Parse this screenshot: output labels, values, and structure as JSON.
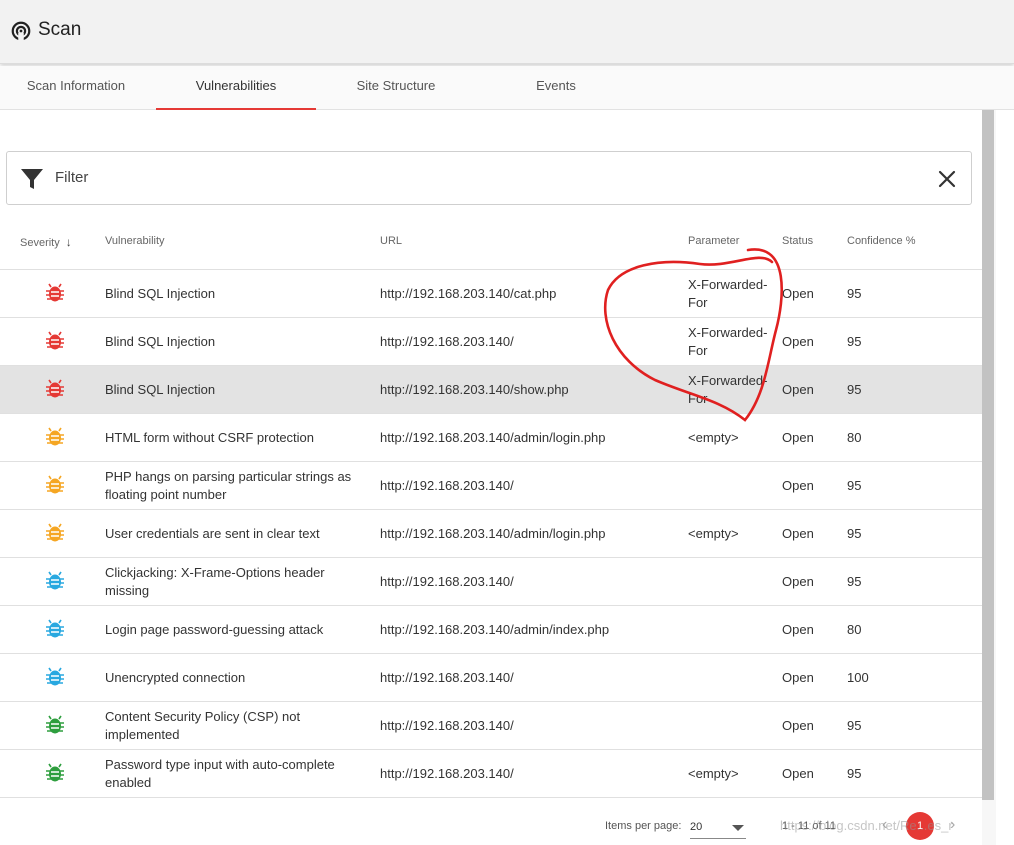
{
  "header": {
    "title": "Scan",
    "icon": "scan-radar-icon"
  },
  "tabs": [
    {
      "label": "Scan Information",
      "active": false
    },
    {
      "label": "Vulnerabilities",
      "active": true
    },
    {
      "label": "Site Structure",
      "active": false
    },
    {
      "label": "Events",
      "active": false
    }
  ],
  "filter": {
    "label": "Filter",
    "icon": "funnel-icon",
    "clear_icon": "close-icon"
  },
  "table": {
    "columns": {
      "severity": "Severity",
      "vulnerability": "Vulnerability",
      "url": "URL",
      "parameter": "Parameter",
      "status": "Status",
      "confidence": "Confidence %"
    },
    "rows": [
      {
        "severity": "high",
        "vulnerability": "Blind SQL Injection",
        "url": "http://192.168.203.140/cat.php",
        "parameter": "X-Forwarded-For",
        "status": "Open",
        "confidence": "95"
      },
      {
        "severity": "high",
        "vulnerability": "Blind SQL Injection",
        "url": "http://192.168.203.140/",
        "parameter": "X-Forwarded-For",
        "status": "Open",
        "confidence": "95"
      },
      {
        "severity": "high",
        "vulnerability": "Blind SQL Injection",
        "url": "http://192.168.203.140/show.php",
        "parameter": "X-Forwarded-For",
        "status": "Open",
        "confidence": "95"
      },
      {
        "severity": "medium",
        "vulnerability": "HTML form without CSRF protection",
        "url": "http://192.168.203.140/admin/login.php",
        "parameter": "<empty>",
        "status": "Open",
        "confidence": "80"
      },
      {
        "severity": "medium",
        "vulnerability": "PHP hangs on parsing particular strings as floating point number",
        "url": "http://192.168.203.140/",
        "parameter": "",
        "status": "Open",
        "confidence": "95"
      },
      {
        "severity": "medium",
        "vulnerability": "User credentials are sent in clear text",
        "url": "http://192.168.203.140/admin/login.php",
        "parameter": "<empty>",
        "status": "Open",
        "confidence": "95"
      },
      {
        "severity": "low",
        "vulnerability": "Clickjacking: X-Frame-Options header missing",
        "url": "http://192.168.203.140/",
        "parameter": "",
        "status": "Open",
        "confidence": "95"
      },
      {
        "severity": "low",
        "vulnerability": "Login page password-guessing attack",
        "url": "http://192.168.203.140/admin/index.php",
        "parameter": "",
        "status": "Open",
        "confidence": "80"
      },
      {
        "severity": "low",
        "vulnerability": "Unencrypted connection",
        "url": "http://192.168.203.140/",
        "parameter": "",
        "status": "Open",
        "confidence": "100"
      },
      {
        "severity": "info",
        "vulnerability": "Content Security Policy (CSP) not implemented",
        "url": "http://192.168.203.140/",
        "parameter": "",
        "status": "Open",
        "confidence": "95"
      },
      {
        "severity": "info",
        "vulnerability": "Password type input with auto-complete enabled",
        "url": "http://192.168.203.140/",
        "parameter": "<empty>",
        "status": "Open",
        "confidence": "95"
      }
    ]
  },
  "severity_colors": {
    "high": "#e53935",
    "medium": "#f5a623",
    "low": "#29a8e0",
    "info": "#2e9e3e"
  },
  "paginator": {
    "items_per_page_label": "Items per page:",
    "items_per_page": "20",
    "range": "1 - 11 of 11",
    "page": "1"
  },
  "watermark": "https://blog.csdn.net/Re...es_r",
  "accent_color": "#e53935"
}
